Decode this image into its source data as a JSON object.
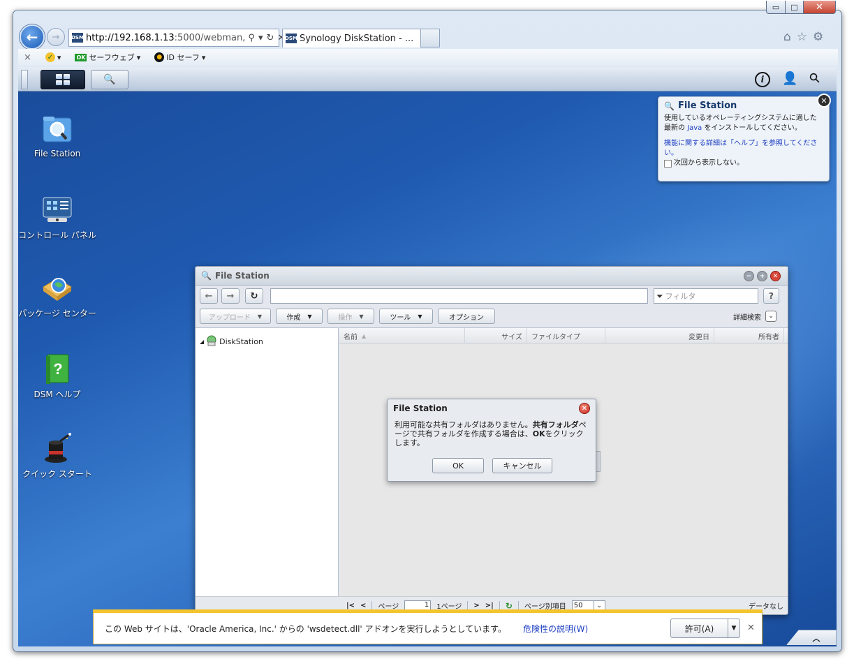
{
  "browser": {
    "url_host": "http://192.168.1.13",
    "url_rest": ":5000/webman,",
    "tab_title": "Synology DiskStation - ...",
    "favicon_text": "DSM",
    "command_bar": {
      "close": "×",
      "safeweb_label": "セーフウェブ",
      "ok_badge": "OK",
      "idsafe_label": "ID セーフ"
    },
    "caption": {
      "min": "▭",
      "max": "□",
      "close": "✕"
    }
  },
  "desktop": {
    "icons": [
      {
        "label": "File Station",
        "icon": "file-station-icon"
      },
      {
        "label": "コントロール パネル",
        "icon": "control-panel-icon"
      },
      {
        "label": "パッケージ センター",
        "icon": "package-center-icon"
      },
      {
        "label": "DSM ヘルプ",
        "icon": "dsm-help-icon"
      },
      {
        "label": "クイック スタート",
        "icon": "quick-start-icon"
      }
    ]
  },
  "notice": {
    "title": "File Station",
    "line1": "使用しているオペレーティングシステムに適した最新の",
    "java_link": "Java",
    "line1_end": "をインストールしてください。",
    "help_text": "機能に関する詳細は「ヘルプ」を参照してください。",
    "dont_show": "次回から表示しない。"
  },
  "file_station": {
    "title": "File Station",
    "filter_placeholder": "フィルタ",
    "help": "?",
    "toolbar": {
      "upload": "アップロード",
      "create": "作成",
      "action": "操作",
      "tools": "ツール",
      "options": "オプション",
      "advanced_search": "詳細検索"
    },
    "tree_root": "DiskStation",
    "columns": {
      "name": "名前",
      "size": "サイズ",
      "file_type": "ファイルタイプ",
      "modified": "変更日",
      "owner": "所有者"
    },
    "pager": {
      "page_label": "ページ",
      "page_value": "1",
      "of_pages": "1ページ",
      "per_page_label": "ページ別項目",
      "per_page_value": "50",
      "status": "データなし"
    }
  },
  "dialog": {
    "title": "File Station",
    "msg_part1": "利用可能な共有フォルダはありません。",
    "msg_bold1": "共有フォルダ",
    "msg_part2": "ページで共有フォルダを作成する場合は、",
    "msg_bold2": "OK",
    "msg_part3": "をクリックします。",
    "ok": "OK",
    "cancel": "キャンセル"
  },
  "infobar": {
    "message": "この Web サイトは、'Oracle America, Inc.' からの 'wsdetect.dll' アドオンを実行しようとしています。",
    "link": "危険性の説明(W)",
    "allow": "許可(A)"
  }
}
